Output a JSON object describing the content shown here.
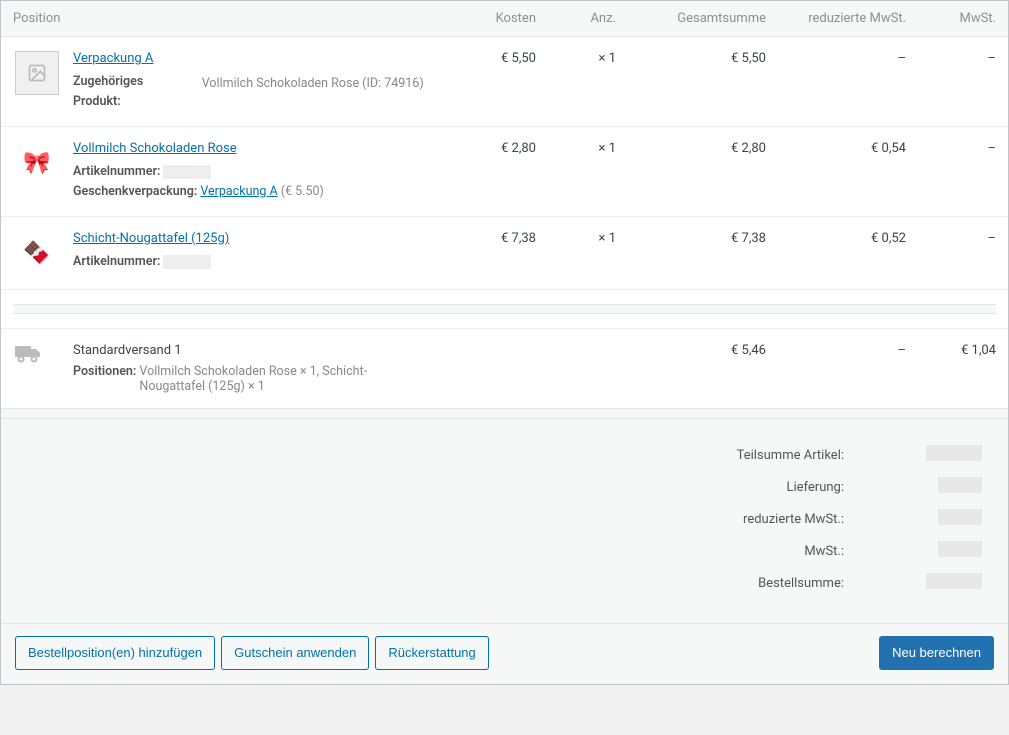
{
  "columns": {
    "position": "Position",
    "cost": "Kosten",
    "qty": "Anz.",
    "total": "Gesamtsumme",
    "reduced_vat": "reduzierte MwSt.",
    "vat": "MwSt."
  },
  "items": [
    {
      "thumb_type": "placeholder",
      "name": "Verpackung A",
      "meta_label_1": "Zugehöriges Produkt:",
      "meta_value_1": "Vollmilch Schokoladen Rose (ID: 74916)",
      "cost": "€ 5,50",
      "qty": "× 1",
      "total": "€ 5,50",
      "reduced_vat": "–",
      "vat": "–"
    },
    {
      "thumb_type": "emoji",
      "thumb_emoji": "🎀",
      "name": "Vollmilch Schokoladen Rose",
      "meta_label_1": "Artikelnummer:",
      "meta_value_1_redacted": true,
      "meta_label_2": "Geschenkverpackung:",
      "meta_link_2": "Verpackung A",
      "meta_suffix_2": "(€ 5.50)",
      "cost": "€ 2,80",
      "qty": "× 1",
      "total": "€ 2,80",
      "reduced_vat": "€ 0,54",
      "vat": "–"
    },
    {
      "thumb_type": "emoji",
      "thumb_emoji": "🍫",
      "name": "Schicht-Nougattafel (125g)",
      "meta_label_1": "Artikelnummer:",
      "meta_value_1_redacted": true,
      "cost": "€ 7,38",
      "qty": "× 1",
      "total": "€ 7,38",
      "reduced_vat": "€ 0,52",
      "vat": "–"
    }
  ],
  "shipping": {
    "name": "Standardversand 1",
    "positions_label": "Positionen:",
    "positions_text": "Vollmilch Schokoladen Rose × 1, Schicht-Nougattafel (125g) × 1",
    "total": "€ 5,46",
    "reduced_vat": "–",
    "vat": "€ 1,04"
  },
  "totals": {
    "subtotal_label": "Teilsumme Artikel:",
    "shipping_label": "Lieferung:",
    "reduced_vat_label": "reduzierte MwSt.:",
    "vat_label": "MwSt.:",
    "order_total_label": "Bestellsumme:"
  },
  "actions": {
    "add_items": "Bestellposition(en) hinzufügen",
    "apply_coupon": "Gutschein anwenden",
    "refund": "Rückerstattung",
    "recalculate": "Neu berechnen"
  }
}
